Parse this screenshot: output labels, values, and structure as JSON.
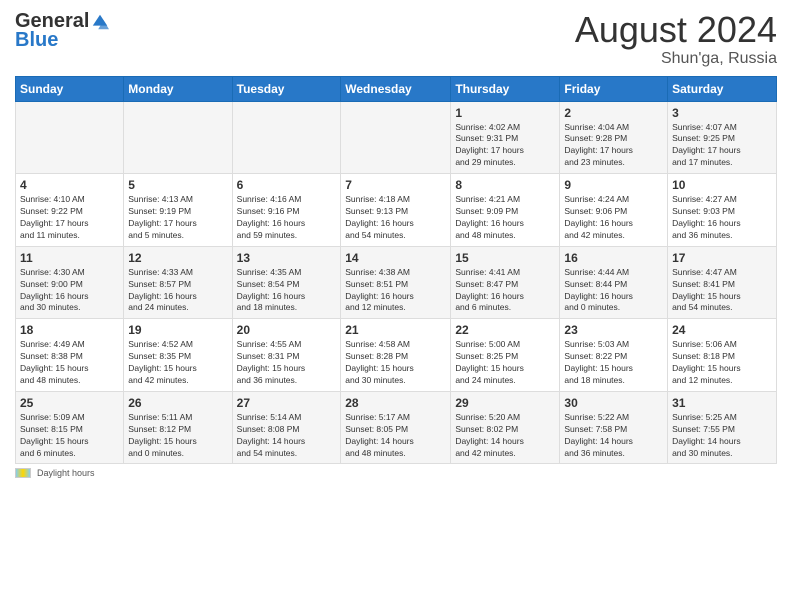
{
  "logo": {
    "general": "General",
    "blue": "Blue"
  },
  "title": {
    "month_year": "August 2024",
    "location": "Shun'ga, Russia"
  },
  "footer": {
    "label": "Daylight hours"
  },
  "calendar": {
    "headers": [
      "Sunday",
      "Monday",
      "Tuesday",
      "Wednesday",
      "Thursday",
      "Friday",
      "Saturday"
    ],
    "weeks": [
      {
        "days": [
          {
            "num": "",
            "info": ""
          },
          {
            "num": "",
            "info": ""
          },
          {
            "num": "",
            "info": ""
          },
          {
            "num": "",
            "info": ""
          },
          {
            "num": "1",
            "info": "Sunrise: 4:02 AM\nSunset: 9:31 PM\nDaylight: 17 hours\nand 29 minutes."
          },
          {
            "num": "2",
            "info": "Sunrise: 4:04 AM\nSunset: 9:28 PM\nDaylight: 17 hours\nand 23 minutes."
          },
          {
            "num": "3",
            "info": "Sunrise: 4:07 AM\nSunset: 9:25 PM\nDaylight: 17 hours\nand 17 minutes."
          }
        ]
      },
      {
        "days": [
          {
            "num": "4",
            "info": "Sunrise: 4:10 AM\nSunset: 9:22 PM\nDaylight: 17 hours\nand 11 minutes."
          },
          {
            "num": "5",
            "info": "Sunrise: 4:13 AM\nSunset: 9:19 PM\nDaylight: 17 hours\nand 5 minutes."
          },
          {
            "num": "6",
            "info": "Sunrise: 4:16 AM\nSunset: 9:16 PM\nDaylight: 16 hours\nand 59 minutes."
          },
          {
            "num": "7",
            "info": "Sunrise: 4:18 AM\nSunset: 9:13 PM\nDaylight: 16 hours\nand 54 minutes."
          },
          {
            "num": "8",
            "info": "Sunrise: 4:21 AM\nSunset: 9:09 PM\nDaylight: 16 hours\nand 48 minutes."
          },
          {
            "num": "9",
            "info": "Sunrise: 4:24 AM\nSunset: 9:06 PM\nDaylight: 16 hours\nand 42 minutes."
          },
          {
            "num": "10",
            "info": "Sunrise: 4:27 AM\nSunset: 9:03 PM\nDaylight: 16 hours\nand 36 minutes."
          }
        ]
      },
      {
        "days": [
          {
            "num": "11",
            "info": "Sunrise: 4:30 AM\nSunset: 9:00 PM\nDaylight: 16 hours\nand 30 minutes."
          },
          {
            "num": "12",
            "info": "Sunrise: 4:33 AM\nSunset: 8:57 PM\nDaylight: 16 hours\nand 24 minutes."
          },
          {
            "num": "13",
            "info": "Sunrise: 4:35 AM\nSunset: 8:54 PM\nDaylight: 16 hours\nand 18 minutes."
          },
          {
            "num": "14",
            "info": "Sunrise: 4:38 AM\nSunset: 8:51 PM\nDaylight: 16 hours\nand 12 minutes."
          },
          {
            "num": "15",
            "info": "Sunrise: 4:41 AM\nSunset: 8:47 PM\nDaylight: 16 hours\nand 6 minutes."
          },
          {
            "num": "16",
            "info": "Sunrise: 4:44 AM\nSunset: 8:44 PM\nDaylight: 16 hours\nand 0 minutes."
          },
          {
            "num": "17",
            "info": "Sunrise: 4:47 AM\nSunset: 8:41 PM\nDaylight: 15 hours\nand 54 minutes."
          }
        ]
      },
      {
        "days": [
          {
            "num": "18",
            "info": "Sunrise: 4:49 AM\nSunset: 8:38 PM\nDaylight: 15 hours\nand 48 minutes."
          },
          {
            "num": "19",
            "info": "Sunrise: 4:52 AM\nSunset: 8:35 PM\nDaylight: 15 hours\nand 42 minutes."
          },
          {
            "num": "20",
            "info": "Sunrise: 4:55 AM\nSunset: 8:31 PM\nDaylight: 15 hours\nand 36 minutes."
          },
          {
            "num": "21",
            "info": "Sunrise: 4:58 AM\nSunset: 8:28 PM\nDaylight: 15 hours\nand 30 minutes."
          },
          {
            "num": "22",
            "info": "Sunrise: 5:00 AM\nSunset: 8:25 PM\nDaylight: 15 hours\nand 24 minutes."
          },
          {
            "num": "23",
            "info": "Sunrise: 5:03 AM\nSunset: 8:22 PM\nDaylight: 15 hours\nand 18 minutes."
          },
          {
            "num": "24",
            "info": "Sunrise: 5:06 AM\nSunset: 8:18 PM\nDaylight: 15 hours\nand 12 minutes."
          }
        ]
      },
      {
        "days": [
          {
            "num": "25",
            "info": "Sunrise: 5:09 AM\nSunset: 8:15 PM\nDaylight: 15 hours\nand 6 minutes."
          },
          {
            "num": "26",
            "info": "Sunrise: 5:11 AM\nSunset: 8:12 PM\nDaylight: 15 hours\nand 0 minutes."
          },
          {
            "num": "27",
            "info": "Sunrise: 5:14 AM\nSunset: 8:08 PM\nDaylight: 14 hours\nand 54 minutes."
          },
          {
            "num": "28",
            "info": "Sunrise: 5:17 AM\nSunset: 8:05 PM\nDaylight: 14 hours\nand 48 minutes."
          },
          {
            "num": "29",
            "info": "Sunrise: 5:20 AM\nSunset: 8:02 PM\nDaylight: 14 hours\nand 42 minutes."
          },
          {
            "num": "30",
            "info": "Sunrise: 5:22 AM\nSunset: 7:58 PM\nDaylight: 14 hours\nand 36 minutes."
          },
          {
            "num": "31",
            "info": "Sunrise: 5:25 AM\nSunset: 7:55 PM\nDaylight: 14 hours\nand 30 minutes."
          }
        ]
      }
    ]
  }
}
